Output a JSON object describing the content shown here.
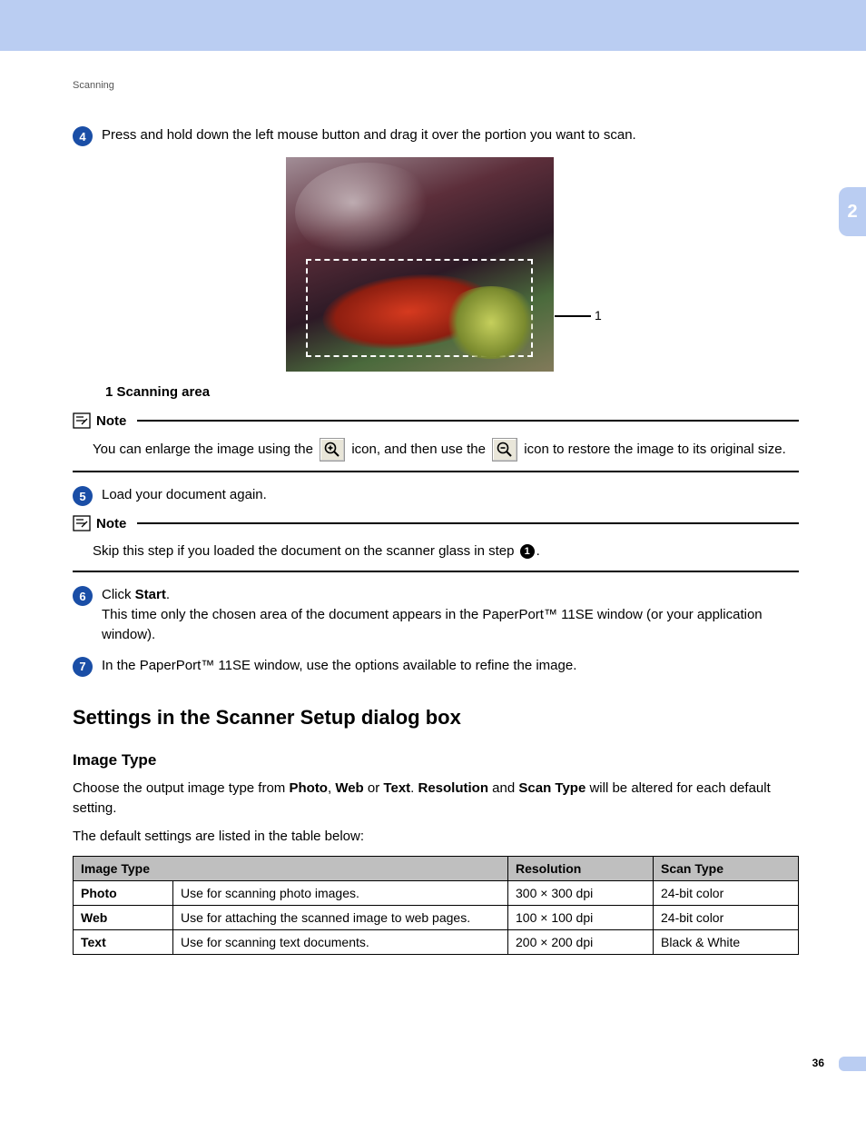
{
  "breadcrumb": "Scanning",
  "section_tab": "2",
  "page_number": "36",
  "step4": {
    "num": "4",
    "text": "Press and hold down the left mouse button and drag it over the portion you want to scan."
  },
  "callout_label": "1",
  "legend": "1   Scanning area",
  "note1": {
    "title": "Note",
    "before_zoom_in": "You can enlarge the image using the ",
    "mid": " icon, and then use the ",
    "after_zoom_out": " icon to restore the image to its original size."
  },
  "step5": {
    "num": "5",
    "text": "Load your document again."
  },
  "note2": {
    "title": "Note",
    "before_ref": "Skip this step if you loaded the document on the scanner glass in step ",
    "ref_num": "1",
    "after_ref": "."
  },
  "step6": {
    "num": "6",
    "line1_prefix": "Click ",
    "line1_bold": "Start",
    "line1_suffix": ".",
    "line2": "This time only the chosen area of the document appears in the PaperPort™ 11SE window (or your application window)."
  },
  "step7": {
    "num": "7",
    "text": "In the PaperPort™ 11SE window, use the options available to refine the image."
  },
  "heading_settings": "Settings in the Scanner Setup dialog box",
  "heading_image_type": "Image Type",
  "image_type_para": {
    "p1a": "Choose the output image type from ",
    "b1": "Photo",
    "c1": ", ",
    "b2": "Web",
    "c2": " or ",
    "b3": "Text",
    "c3": ". ",
    "b4": "Resolution",
    "c4": " and ",
    "b5": "Scan Type",
    "c5": " will be altered for each default setting."
  },
  "table_intro": "The default settings are listed in the table below:",
  "table": {
    "headers": {
      "c1": "Image Type",
      "c2": "Resolution",
      "c3": "Scan Type"
    },
    "rows": [
      {
        "label": "Photo",
        "desc": "Use for scanning photo images.",
        "res": "300 × 300 dpi",
        "scan": "24-bit color"
      },
      {
        "label": "Web",
        "desc": "Use for attaching the scanned image to web pages.",
        "res": "100 × 100 dpi",
        "scan": "24-bit color"
      },
      {
        "label": "Text",
        "desc": "Use for scanning text documents.",
        "res": "200 × 200 dpi",
        "scan": "Black & White"
      }
    ]
  }
}
